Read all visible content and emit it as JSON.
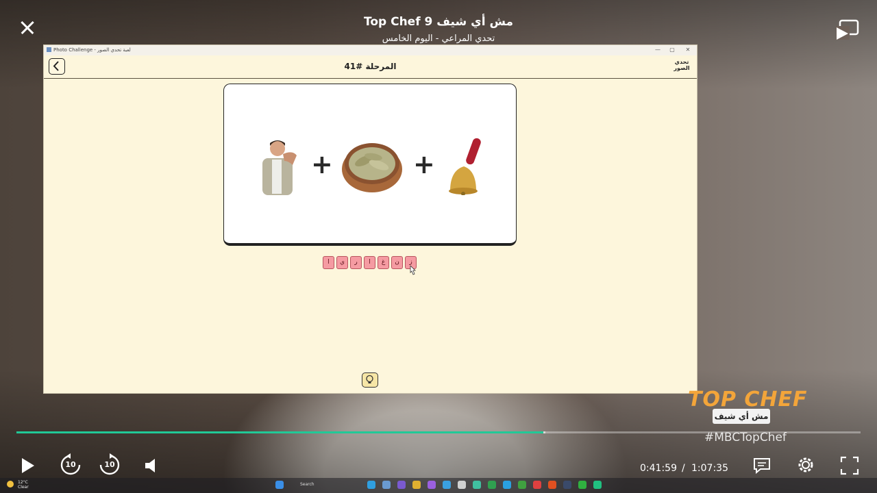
{
  "player": {
    "title": "Top Chef مش أي شيف 9",
    "subtitle": "تحدي المراعي - اليوم الخامس",
    "current_time": "0:41:59",
    "separator": "/",
    "duration": "1:07:35",
    "progress_fraction": 0.624,
    "buffered_fraction": 0.627,
    "skip_back_label": "10",
    "skip_forward_label": "10",
    "brand_logo": "TOP CHEF",
    "brand_subtitle": "مش أي شيف",
    "hashtag": "#MBCTopChef",
    "accent_color": "#21c997"
  },
  "window": {
    "title": "Photo Challenge - لعبة تحدي الصور",
    "minimize": "—",
    "maximize": "▢",
    "close": "✕"
  },
  "app": {
    "stage_title": "المرحلة #41",
    "logo_text": "تحدي الصور",
    "puzzle_items": [
      "person-shouting-image",
      "bay-leaves-bowl-image",
      "hand-bell-image"
    ],
    "letters": [
      "ا",
      "ي",
      "ر",
      "ا",
      "غ",
      "ن",
      "ز"
    ],
    "tile_color": "#f59ba2"
  },
  "taskbar": {
    "temperature": "12°C",
    "condition": "Clear",
    "search_placeholder": "Search"
  }
}
